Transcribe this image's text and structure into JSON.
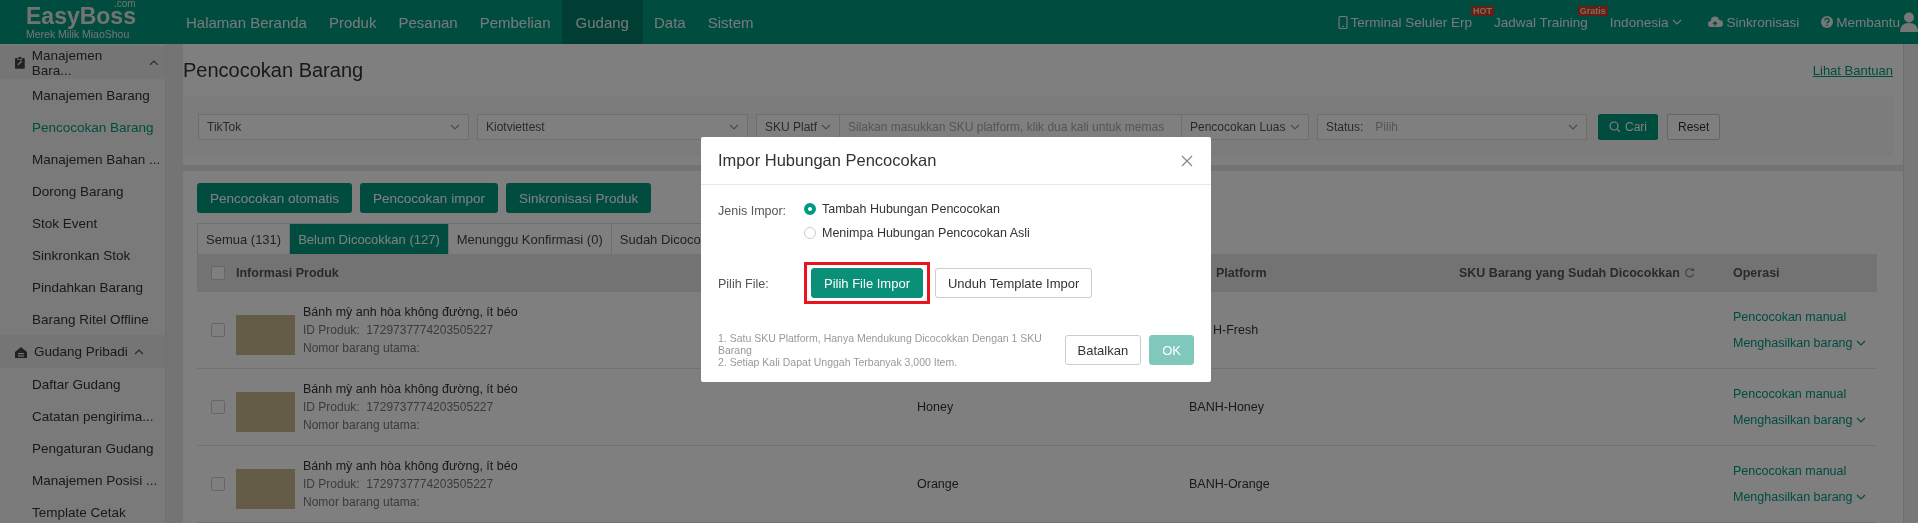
{
  "topbar": {
    "logo": {
      "name": "EasyBoss",
      "domain": ".com",
      "tagline": "Merek Milik MiaoShou"
    },
    "nav": [
      {
        "label": "Halaman Beranda",
        "selected": false
      },
      {
        "label": "Produk",
        "selected": false
      },
      {
        "label": "Pesanan",
        "selected": false
      },
      {
        "label": "Pembelian",
        "selected": false
      },
      {
        "label": "Gudang",
        "selected": true
      },
      {
        "label": "Data",
        "selected": false
      },
      {
        "label": "Sistem",
        "selected": false
      }
    ],
    "right": [
      {
        "kind": "phone",
        "label": "Terminal Seluler Erp",
        "badge": "HOT"
      },
      {
        "kind": "plain",
        "label": "Jadwal Training",
        "badge": "Gratis"
      },
      {
        "kind": "dropdown",
        "label": "Indonesia"
      },
      {
        "kind": "sync",
        "label": "Sinkronisasi"
      },
      {
        "kind": "help",
        "label": "Membantu"
      },
      {
        "kind": "avatar"
      }
    ]
  },
  "sidebar": [
    {
      "label": "Manajemen Bara...",
      "expanded": true,
      "items": [
        {
          "label": "Manajemen Barang",
          "selected": false
        },
        {
          "label": "Pencocokan Barang",
          "selected": true
        },
        {
          "label": "Manajemen Bahan ...",
          "selected": false
        },
        {
          "label": "Dorong Barang",
          "selected": false
        },
        {
          "label": "Stok Event",
          "selected": false
        },
        {
          "label": "Sinkronkan Stok",
          "selected": false
        },
        {
          "label": "Pindahkan Barang",
          "selected": false
        },
        {
          "label": "Barang Ritel Offline",
          "selected": false
        }
      ]
    },
    {
      "label": "Gudang Pribadi",
      "expanded": true,
      "items": [
        {
          "label": "Daftar Gudang",
          "selected": false
        },
        {
          "label": "Catatan pengirima...",
          "selected": false
        },
        {
          "label": "Pengaturan Gudang",
          "selected": false
        },
        {
          "label": "Manajemen Posisi ...",
          "selected": false
        },
        {
          "label": "Template Cetak",
          "selected": false
        }
      ]
    }
  ],
  "page": {
    "title": "Pencocokan Barang",
    "help_link": "Lihat Bantuan"
  },
  "filters": [
    {
      "kind": "select",
      "value": "TikTok"
    },
    {
      "kind": "select",
      "value": "Kiotviettest"
    },
    {
      "kind": "prefix",
      "value": "SKU Platf"
    },
    {
      "kind": "input",
      "placeholder": "Silakan masukkan SKU platform, klik dua kali untuk memas"
    },
    {
      "kind": "mode",
      "value": "Pencocokan Luas"
    },
    {
      "kind": "labeled-select",
      "label": "Status:",
      "placeholder": "Pilih"
    },
    {
      "kind": "button",
      "label": "Cari",
      "primary": true
    },
    {
      "kind": "button",
      "label": "Reset",
      "primary": false
    }
  ],
  "actions": [
    "Pencocokan otomatis",
    "Pencocokan impor",
    "Sinkronisasi Produk"
  ],
  "tabs": [
    {
      "label": "Semua (131)",
      "selected": false
    },
    {
      "label": "Belum Dicocokkan (127)",
      "selected": true
    },
    {
      "label": "Menunggu Konfirmasi (0)",
      "selected": false
    },
    {
      "label": "Sudah Dicoco",
      "selected": false
    }
  ],
  "table": {
    "select_all": {
      "checked": false
    },
    "columns": [
      {
        "label": "Informasi Produk"
      },
      {},
      {
        "label": "Platform"
      },
      {
        "label": "SKU Barang yang Sudah Dicocokkan"
      },
      {
        "label": "Operasi"
      }
    ],
    "rows": [
      {
        "checked": false,
        "product": {
          "name": "Bánh mỳ anh hòa không đường, ít béo",
          "id_label": "ID Produk:",
          "id": "1729737774203505227",
          "main_no_label": "Nomor barang utama:"
        },
        "column_3": "H-Fresh",
        "operations": [
          "Pencocokan manual",
          "Menghasilkan barang"
        ]
      },
      {
        "checked": false,
        "product": {
          "name": "Bánh mỳ anh hòa không đường, ít béo",
          "id_label": "ID Produk:",
          "id": "1729737774203505227",
          "main_no_label": "Nomor barang utama:"
        },
        "column_2": "Honey",
        "column_3": "BANH-Honey",
        "operations": [
          "Pencocokan manual",
          "Menghasilkan barang"
        ]
      },
      {
        "checked": false,
        "product": {
          "name": "Bánh mỳ anh hòa không đường, ít béo",
          "id_label": "ID Produk:",
          "id": "1729737774203505227",
          "main_no_label": "Nomor barang utama:"
        },
        "column_2": "Orange",
        "column_3": "BANH-Orange",
        "operations": [
          "Pencocokan manual",
          "Menghasilkan barang"
        ]
      }
    ]
  },
  "dialog": {
    "title": "Impor Hubungan Pencocokan",
    "import_type": {
      "label": "Jenis Impor:",
      "options": [
        {
          "label": "Tambah Hubungan Pencocokan",
          "selected": true
        },
        {
          "label": "Menimpa Hubungan Pencocokan Asli",
          "selected": false
        }
      ]
    },
    "file": {
      "label": "Pilih File:",
      "buttons": [
        {
          "label": "Pilih File Impor",
          "kind": "primary",
          "highlighted": true
        },
        {
          "label": "Unduh Template Impor",
          "kind": "default",
          "highlighted": false
        }
      ]
    },
    "notes": [
      "1. Satu SKU Platform, Hanya Mendukung Dicocokkan Dengan 1 SKU Barang",
      "2. Setiap Kali Dapat Unggah Terbanyak 3,000 Item."
    ],
    "footer": [
      {
        "label": "Batalkan",
        "kind": "default",
        "disabled": false
      },
      {
        "label": "OK",
        "kind": "primary",
        "disabled": true
      }
    ]
  }
}
